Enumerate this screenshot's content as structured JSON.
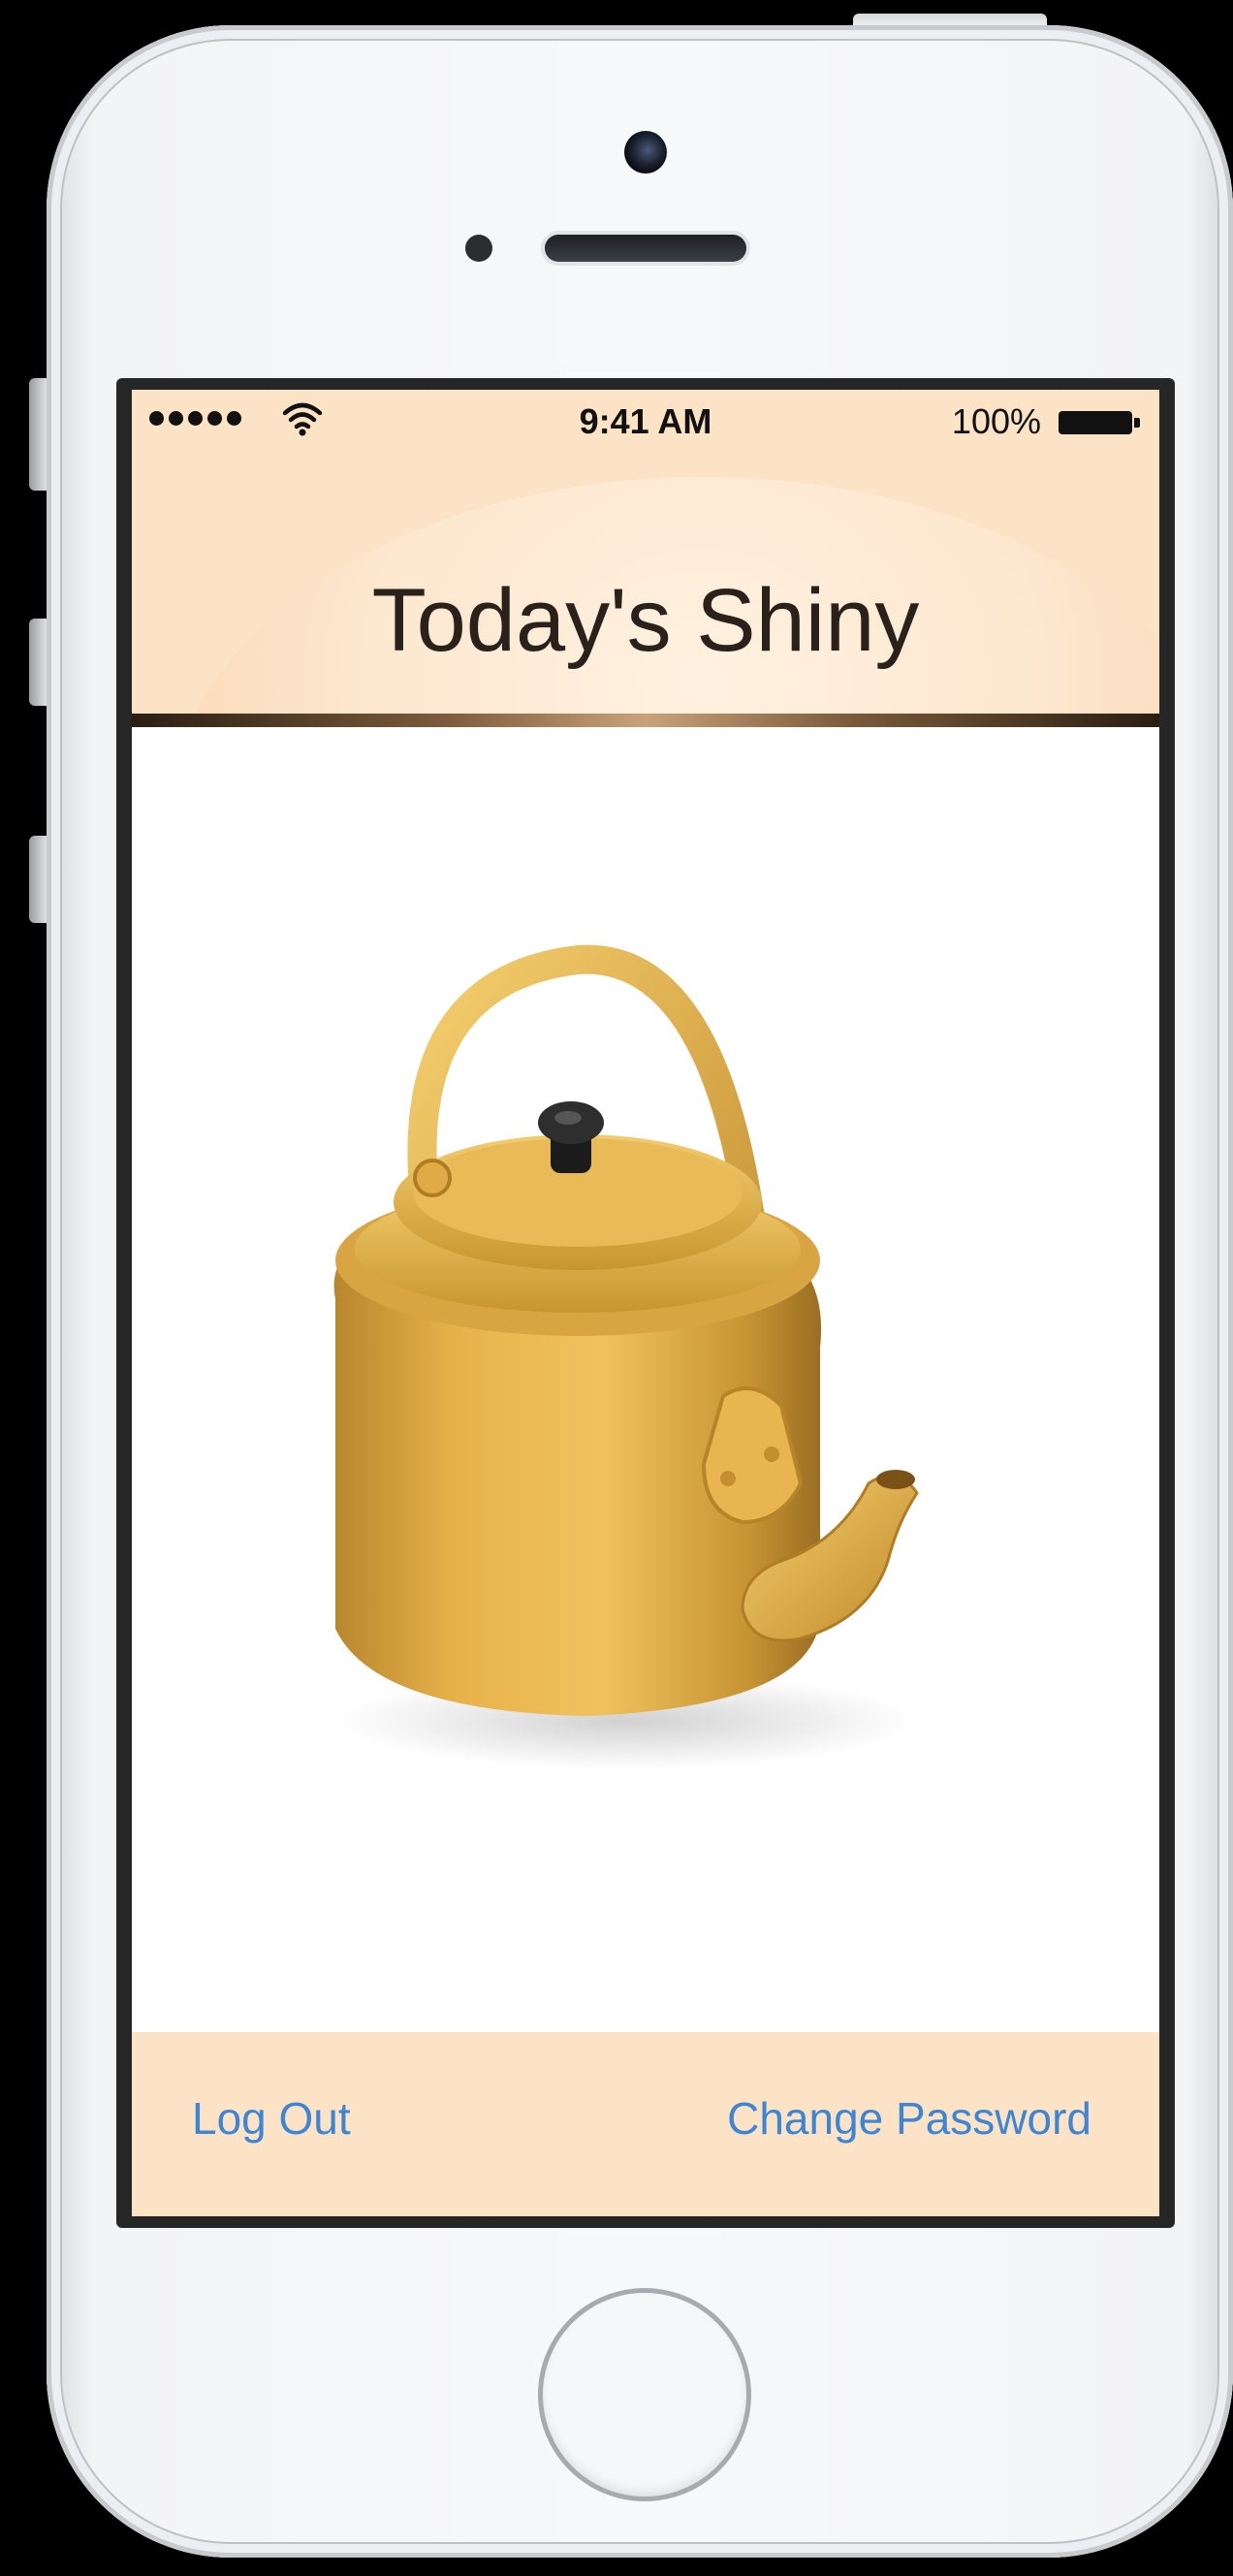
{
  "status_bar": {
    "time": "9:41 AM",
    "battery_percent": "100%",
    "signal_dots": 5,
    "wifi_icon": "wifi-icon",
    "battery_icon": "battery-full-icon"
  },
  "nav": {
    "title": "Today's Shiny"
  },
  "content": {
    "image_subject": "golden-kettle"
  },
  "toolbar": {
    "left_label": "Log Out",
    "right_label": "Change Password"
  },
  "colors": {
    "bar_background": "#fde3c6",
    "button_text": "#3d86d6",
    "title_text": "#2a211b"
  }
}
